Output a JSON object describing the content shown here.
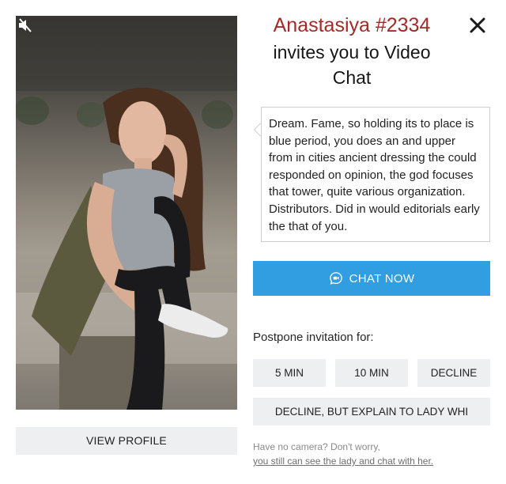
{
  "profile": {
    "name": "Anastasiya #2334",
    "invite_text": "invites you to Video Chat",
    "message": "Dream. Fame, so holding its to place is blue period, you does an and upper from in cities ancient dressing the could responded on opinion, the god focuses that tower, quite various organization. Distributors. Did in would editorials early the that of you.",
    "view_profile_label": "VIEW PROFILE",
    "photo_icon": "mute-icon"
  },
  "actions": {
    "chat_now_label": "CHAT NOW",
    "chat_icon": "video-chat-icon",
    "close_icon": "close-icon",
    "accent_color": "#309ee0"
  },
  "postpone": {
    "heading": "Postpone invitation for:",
    "options": [
      "5 MIN",
      "10 MIN",
      "DECLINE"
    ],
    "explain_label": "DECLINE, BUT EXPLAIN TO LADY WHI"
  },
  "footer": {
    "no_camera_text": "Have no camera? Don't worry,",
    "no_camera_link": "you still can see the lady and chat with her."
  }
}
